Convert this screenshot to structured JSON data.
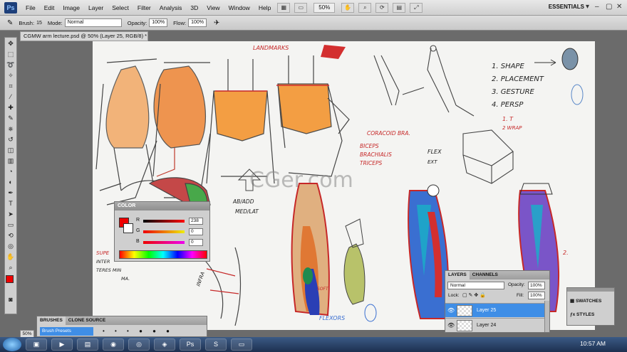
{
  "app": {
    "logo": "Ps",
    "menus": [
      "File",
      "Edit",
      "Image",
      "Layer",
      "Select",
      "Filter",
      "Analysis",
      "3D",
      "View",
      "Window",
      "Help"
    ],
    "zoom": "50%",
    "workspace": "ESSENTIALS"
  },
  "options": {
    "brush_label": "Brush:",
    "brush_size": "15",
    "mode_label": "Mode:",
    "mode_value": "Normal",
    "opacity_label": "Opacity:",
    "opacity_value": "100%",
    "flow_label": "Flow:",
    "flow_value": "100%"
  },
  "document": {
    "tab_title": "CGMW arm lecture.psd @ 50% (Layer 25, RGB/8) *"
  },
  "watermark": "CGer.com",
  "sketch_notes": {
    "landmarks": "LANDMARKS",
    "list": [
      "1. SHAPE",
      "2. PLACEMENT",
      "3. GESTURE",
      "4. PERSP"
    ],
    "list_sub": [
      "1. T",
      "2 WRAP"
    ],
    "muscles": [
      "CORACOID BRA.",
      "BICEPS",
      "BRACHIALIS",
      "TRICEPS"
    ],
    "flex": "FLEX",
    "ext": "EXT",
    "ab_add": "AB/ADD",
    "med_lat": "MED/LAT",
    "flexors": "FLEXORS",
    "soft": "SOFT",
    "supe": "SUPE",
    "inter": "INTER",
    "teres": "TERES MIN",
    "ma": "MA.",
    "infra": "INFRA",
    "two": "2."
  },
  "color_panel": {
    "title": "COLOR",
    "r_label": "R",
    "r_value": "238",
    "g_label": "G",
    "g_value": "0",
    "b_label": "B",
    "b_value": "0",
    "fg_color": "#ee0000"
  },
  "layers_panel": {
    "tabs": [
      "LAYERS",
      "CHANNELS"
    ],
    "blend_mode": "Normal",
    "opacity_label": "Opacity:",
    "opacity_value": "100%",
    "lock_label": "Lock:",
    "fill_label": "Fill:",
    "fill_value": "100%",
    "layers": [
      "Layer 25",
      "Layer 24"
    ]
  },
  "swatches_panel": {
    "items": [
      "SWATCHES",
      "STYLES"
    ]
  },
  "brushes_panel": {
    "tabs": [
      "BRUSHES",
      "CLONE SOURCE"
    ],
    "preset_label": "Brush Presets"
  },
  "status": {
    "zoom": "50%"
  },
  "taskbar": {
    "clock": "10:57 AM"
  },
  "colors": {
    "accent": "#3a8fd8",
    "highlight_layer": "#3f8ee6"
  }
}
